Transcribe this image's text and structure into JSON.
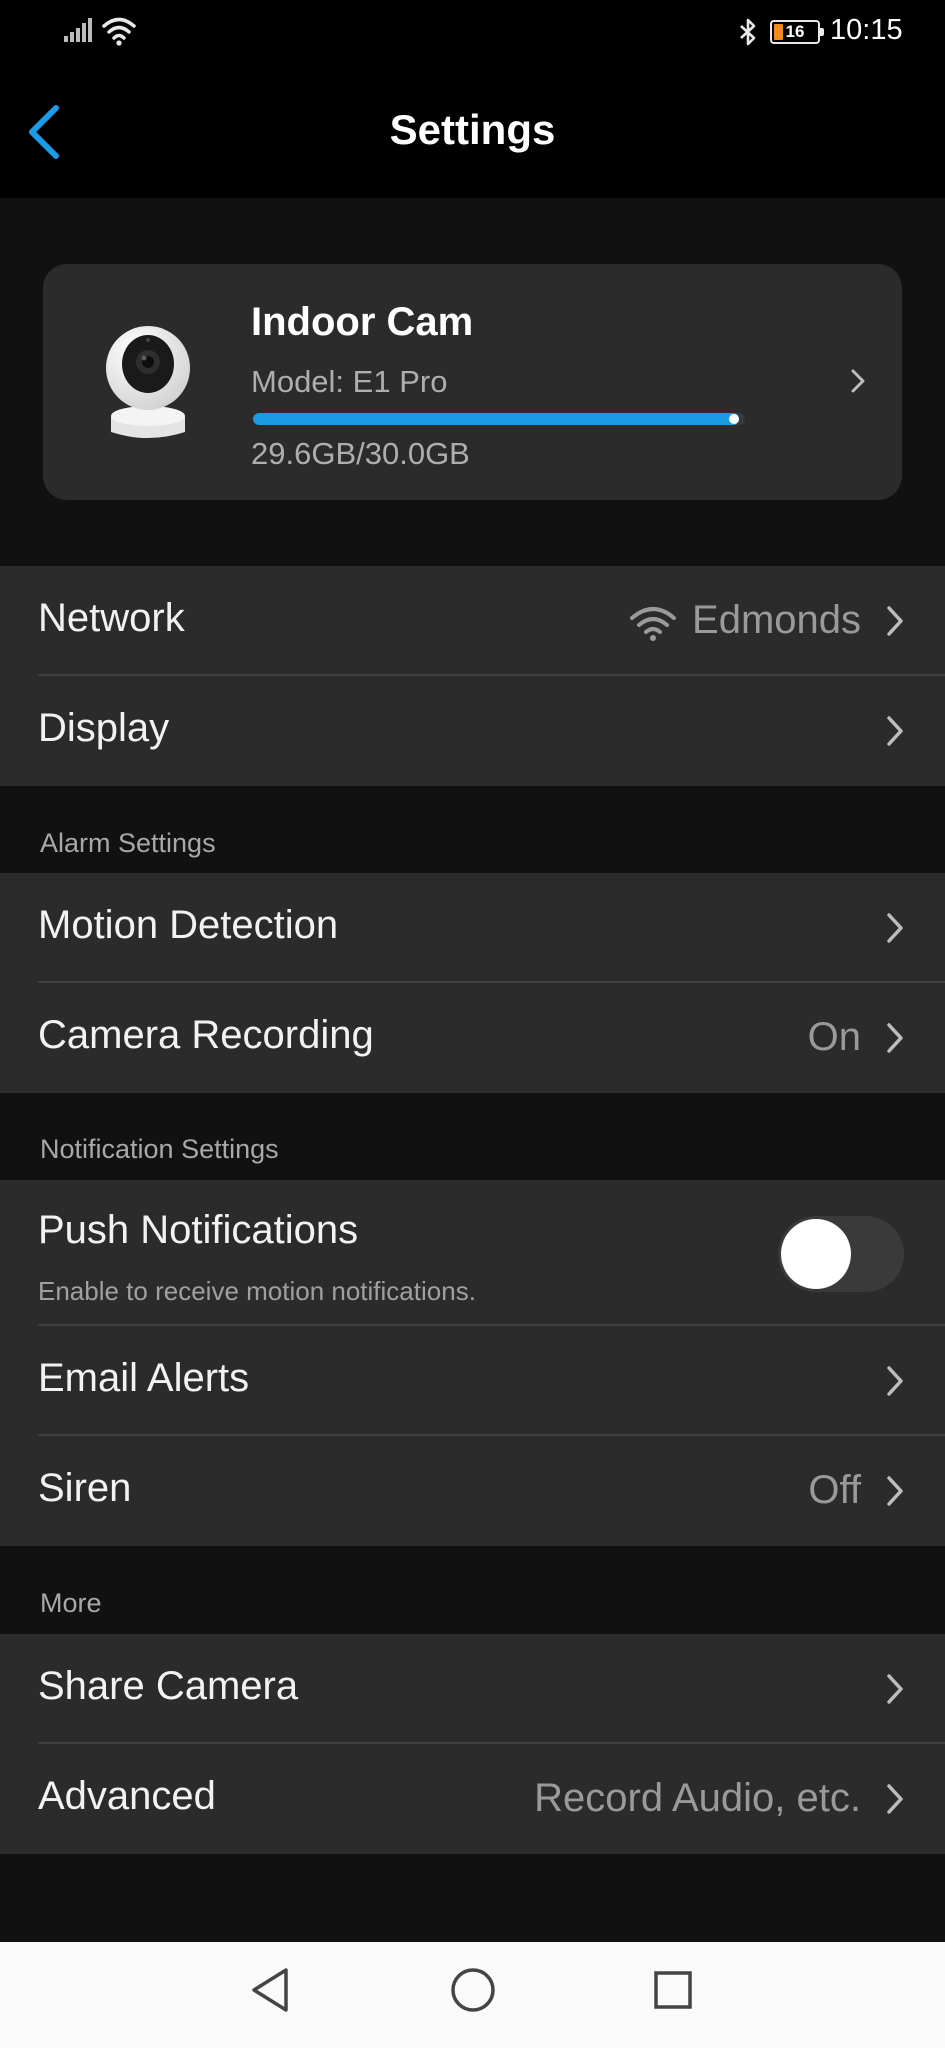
{
  "status_bar": {
    "time": "10:15",
    "battery": "16"
  },
  "header": {
    "title": "Settings"
  },
  "device": {
    "name": "Indoor Cam",
    "model": "Model: E1 Pro",
    "storage_text": "29.6GB/30.0GB",
    "storage_used_fraction": 0.987
  },
  "groups": {
    "general": {
      "network_label": "Network",
      "network_value": "Edmonds",
      "display_label": "Display"
    },
    "alarm": {
      "section_label": "Alarm Settings",
      "motion_label": "Motion Detection",
      "recording_label": "Camera Recording",
      "recording_value": "On"
    },
    "notification": {
      "section_label": "Notification Settings",
      "push_label": "Push Notifications",
      "push_subtitle": "Enable to receive motion notifications.",
      "push_enabled": false,
      "email_label": "Email Alerts",
      "siren_label": "Siren",
      "siren_value": "Off"
    },
    "more": {
      "section_label": "More",
      "share_label": "Share Camera",
      "advanced_label": "Advanced",
      "advanced_value": "Record Audio, etc."
    }
  },
  "colors": {
    "accent": "#1c9be5",
    "background": "#111111",
    "surface": "#2b2b2c",
    "battery": "#f08a1c"
  }
}
